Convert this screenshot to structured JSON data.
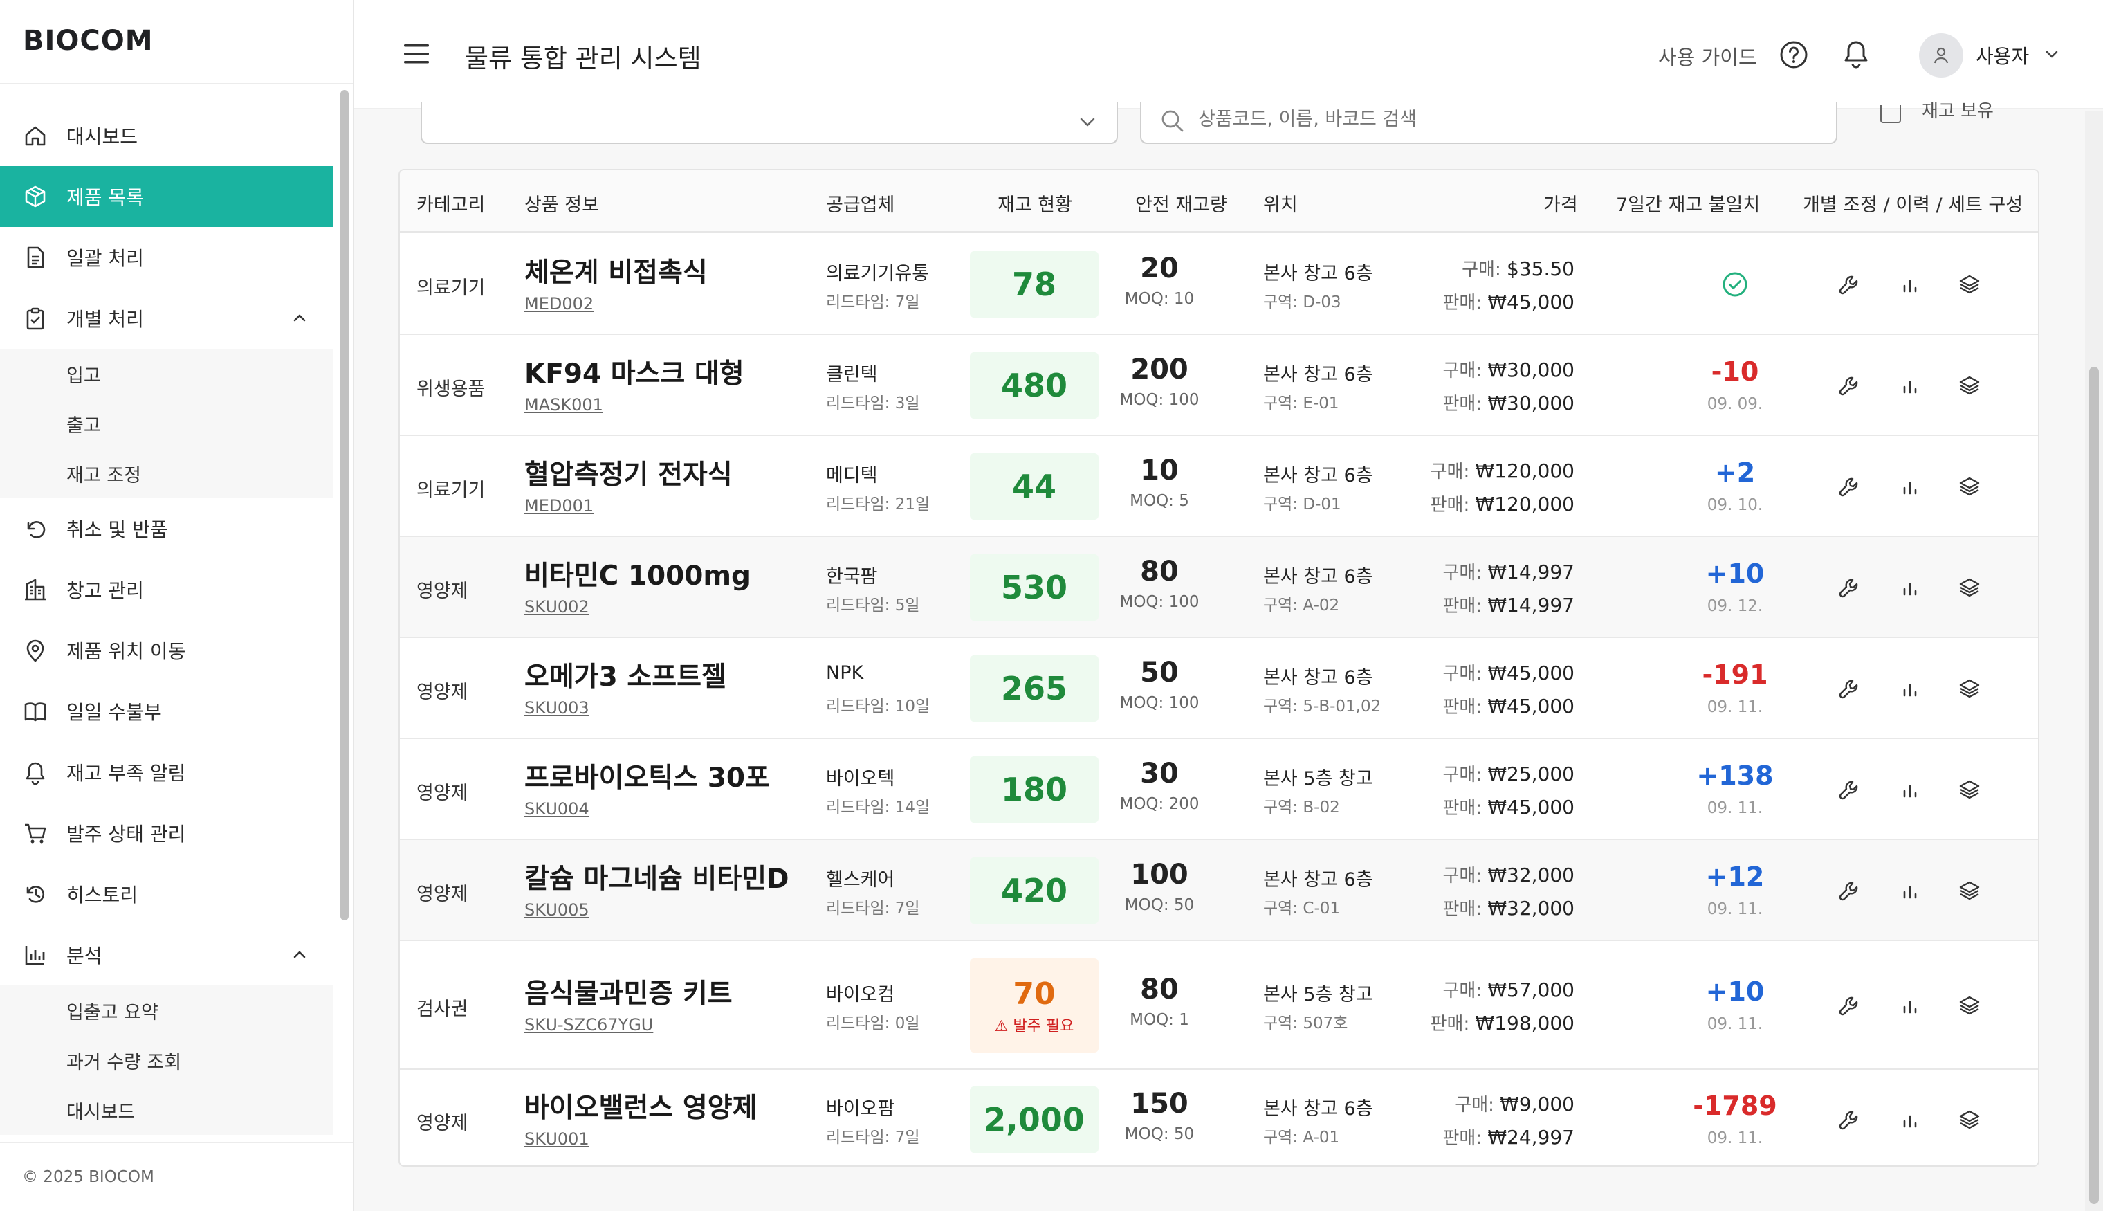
{
  "sidebar": {
    "logo": "BIOCOM",
    "items": [
      {
        "label": "대시보드",
        "icon": "home-icon"
      },
      {
        "label": "제품 목록",
        "icon": "box-icon",
        "active": true
      },
      {
        "label": "일괄 처리",
        "icon": "document-icon"
      },
      {
        "label": "개별 처리",
        "icon": "clipboard-icon",
        "expanded": true,
        "children": [
          "입고",
          "출고",
          "재고 조정"
        ]
      },
      {
        "label": "취소 및 반품",
        "icon": "undo-icon"
      },
      {
        "label": "창고 관리",
        "icon": "building-icon"
      },
      {
        "label": "제품 위치 이동",
        "icon": "location-pin-icon"
      },
      {
        "label": "일일 수불부",
        "icon": "book-icon"
      },
      {
        "label": "재고 부족 알림",
        "icon": "bell-icon"
      },
      {
        "label": "발주 상태 관리",
        "icon": "cart-icon"
      },
      {
        "label": "히스토리",
        "icon": "history-icon"
      },
      {
        "label": "분석",
        "icon": "bar-chart-icon",
        "expanded": true,
        "children": [
          "입출고 요약",
          "과거 수량 조회",
          "대시보드"
        ]
      }
    ],
    "footer": "© 2025 BIOCOM"
  },
  "header": {
    "title": "물류 통합 관리 시스템",
    "guide": "사용 가이드",
    "user": "사용자"
  },
  "filters": {
    "search_placeholder": "상품코드, 이름, 바코드 검색",
    "checkbox_label": "재고 보유"
  },
  "table": {
    "columns": [
      "카테고리",
      "상품 정보",
      "공급업체",
      "재고 현황",
      "안전 재고량",
      "위치",
      "가격",
      "7일간 재고 불일치",
      "개별 조정 / 이력 / 세트 구성"
    ],
    "rows": [
      {
        "category": "의료기기",
        "name": "체온계 비접촉식",
        "code": "MED002",
        "supplier": "의료기기유통",
        "lead": "리드타임: 7일",
        "stock": "78",
        "safety": "20",
        "moq": "MOQ: 10",
        "location": "본사 창고 6층",
        "zone": "구역: D-03",
        "buy": "$35.50",
        "sell": "₩45,000",
        "discrepancy": "",
        "date": "",
        "status": "ok"
      },
      {
        "category": "위생용품",
        "name": "KF94 마스크 대형",
        "code": "MASK001",
        "supplier": "클린텍",
        "lead": "리드타임: 3일",
        "stock": "480",
        "safety": "200",
        "moq": "MOQ: 100",
        "location": "본사 창고 6층",
        "zone": "구역: E-01",
        "buy": "₩30,000",
        "sell": "₩30,000",
        "discrepancy": "-10",
        "date": "09. 09.",
        "status": "neg"
      },
      {
        "category": "의료기기",
        "name": "혈압측정기 전자식",
        "code": "MED001",
        "supplier": "메디텍",
        "lead": "리드타임: 21일",
        "stock": "44",
        "safety": "10",
        "moq": "MOQ: 5",
        "location": "본사 창고 6층",
        "zone": "구역: D-01",
        "buy": "₩120,000",
        "sell": "₩120,000",
        "discrepancy": "+2",
        "date": "09. 10.",
        "status": "pos"
      },
      {
        "category": "영양제",
        "name": "비타민C 1000mg",
        "code": "SKU002",
        "supplier": "한국팜",
        "lead": "리드타임: 5일",
        "stock": "530",
        "safety": "80",
        "moq": "MOQ: 100",
        "location": "본사 창고 6층",
        "zone": "구역: A-02",
        "buy": "₩14,997",
        "sell": "₩14,997",
        "discrepancy": "+10",
        "date": "09. 12.",
        "status": "pos"
      },
      {
        "category": "영양제",
        "name": "오메가3 소프트젤",
        "code": "SKU003",
        "supplier": "NPK",
        "lead": "리드타임: 10일",
        "stock": "265",
        "safety": "50",
        "moq": "MOQ: 100",
        "location": "본사 창고 6층",
        "zone": "구역: 5-B-01,02",
        "buy": "₩45,000",
        "sell": "₩45,000",
        "discrepancy": "-191",
        "date": "09. 11.",
        "status": "neg"
      },
      {
        "category": "영양제",
        "name": "프로바이오틱스 30포",
        "code": "SKU004",
        "supplier": "바이오텍",
        "lead": "리드타임: 14일",
        "stock": "180",
        "safety": "30",
        "moq": "MOQ: 200",
        "location": "본사 5층 창고",
        "zone": "구역: B-02",
        "buy": "₩25,000",
        "sell": "₩45,000",
        "discrepancy": "+138",
        "date": "09. 11.",
        "status": "pos"
      },
      {
        "category": "영양제",
        "name": "칼슘 마그네슘 비타민D",
        "code": "SKU005",
        "supplier": "헬스케어",
        "lead": "리드타임: 7일",
        "stock": "420",
        "safety": "100",
        "moq": "MOQ: 50",
        "location": "본사 창고 6층",
        "zone": "구역: C-01",
        "buy": "₩32,000",
        "sell": "₩32,000",
        "discrepancy": "+12",
        "date": "09. 11.",
        "status": "pos"
      },
      {
        "category": "검사권",
        "name": "음식물과민증 키트",
        "code": "SKU-SZC67YGU",
        "supplier": "바이오컴",
        "lead": "리드타임: 0일",
        "stock": "70",
        "warning": "⚠ 발주 필요",
        "safety": "80",
        "moq": "MOQ: 1",
        "location": "본사 5층 창고",
        "zone": "구역: 507호",
        "buy": "₩57,000",
        "sell": "₩198,000",
        "discrepancy": "+10",
        "date": "09. 11.",
        "status": "pos"
      },
      {
        "category": "영양제",
        "name": "바이오밸런스 영양제",
        "code": "SKU001",
        "supplier": "바이오팜",
        "lead": "리드타임: 7일",
        "stock": "2,000",
        "safety": "150",
        "moq": "MOQ: 50",
        "location": "본사 창고 6층",
        "zone": "구역: A-01",
        "buy": "₩9,000",
        "sell": "₩24,997",
        "discrepancy": "-1789",
        "date": "09. 11.",
        "status": "neg"
      }
    ],
    "buy_label": "구매:",
    "sell_label": "판매:"
  },
  "colors": {
    "accent": "#1ab3a0",
    "negative": "#d92b2b",
    "positive": "#2266d6",
    "stock_ok": "#1f8a3b",
    "stock_warn": "#e06a10"
  }
}
